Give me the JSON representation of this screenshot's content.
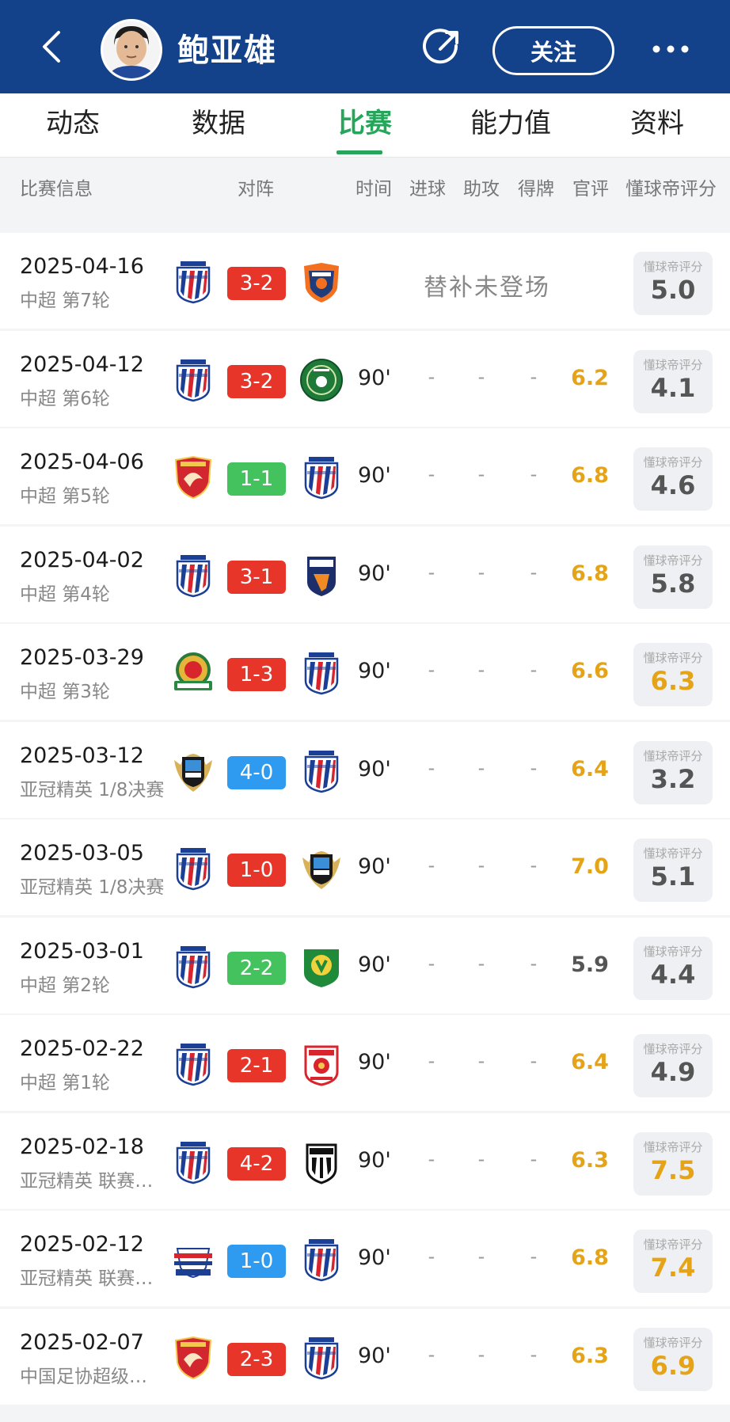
{
  "header": {
    "player_name": "鲍亚雄",
    "follow_label": "关注",
    "color": "#14428a"
  },
  "tabs": [
    {
      "label": "动态"
    },
    {
      "label": "数据"
    },
    {
      "label": "比赛",
      "active": true
    },
    {
      "label": "能力值"
    },
    {
      "label": "资料"
    }
  ],
  "columns": {
    "info": "比赛信息",
    "match": "对阵",
    "time": "时间",
    "goals": "进球",
    "assists": "助攻",
    "cards": "得牌",
    "official": "官评",
    "dqd": "懂球帝评分"
  },
  "rating_label": "懂球帝评分",
  "colors": {
    "accent_green": "#27a55a",
    "score_loss": "#e8352a",
    "score_draw": "#44c25e",
    "score_win": "#2e9bf0",
    "rating_gold": "#e5a418",
    "rating_gray": "#555555"
  },
  "matches": [
    {
      "date": "2025-04-16",
      "comp": "中超 第7轮",
      "home_icon": "shenhua-crest-icon",
      "score": "3-2",
      "score_color": "red",
      "away_icon": "dalian-crest-icon",
      "not_played": "替补未登场",
      "dqd": "5.0",
      "dqd_high": false
    },
    {
      "date": "2025-04-12",
      "comp": "中超 第6轮",
      "home_icon": "shenhua-crest-icon",
      "score": "3-2",
      "score_color": "red",
      "away_icon": "zhejiang-crest-icon",
      "time": "90'",
      "goals": "-",
      "assists": "-",
      "cards": "-",
      "official": "6.2",
      "official_high": true,
      "dqd": "4.1",
      "dqd_high": false
    },
    {
      "date": "2025-04-06",
      "comp": "中超 第5轮",
      "home_icon": "shanghai-port-crest-icon",
      "score": "1-1",
      "score_color": "green",
      "away_icon": "shenhua-crest-icon",
      "time": "90'",
      "goals": "-",
      "assists": "-",
      "cards": "-",
      "official": "6.8",
      "official_high": true,
      "dqd": "4.6",
      "dqd_high": false
    },
    {
      "date": "2025-04-02",
      "comp": "中超 第4轮",
      "home_icon": "shenhua-crest-icon",
      "score": "3-1",
      "score_color": "red",
      "away_icon": "yunnan-crest-icon",
      "time": "90'",
      "goals": "-",
      "assists": "-",
      "cards": "-",
      "official": "6.8",
      "official_high": true,
      "dqd": "5.8",
      "dqd_high": false
    },
    {
      "date": "2025-03-29",
      "comp": "中超 第3轮",
      "home_icon": "henan-crest-icon",
      "score": "1-3",
      "score_color": "red",
      "away_icon": "shenhua-crest-icon",
      "time": "90'",
      "goals": "-",
      "assists": "-",
      "cards": "-",
      "official": "6.6",
      "official_high": true,
      "dqd": "6.3",
      "dqd_high": true
    },
    {
      "date": "2025-03-12",
      "comp": "亚冠精英 1/8决赛",
      "home_icon": "kawasaki-crest-icon",
      "score": "4-0",
      "score_color": "blue",
      "away_icon": "shenhua-crest-icon",
      "time": "90'",
      "goals": "-",
      "assists": "-",
      "cards": "-",
      "official": "6.4",
      "official_high": true,
      "dqd": "3.2",
      "dqd_high": false
    },
    {
      "date": "2025-03-05",
      "comp": "亚冠精英 1/8决赛",
      "home_icon": "shenhua-crest-icon",
      "score": "1-0",
      "score_color": "red",
      "away_icon": "kawasaki-crest-icon",
      "time": "90'",
      "goals": "-",
      "assists": "-",
      "cards": "-",
      "official": "7.0",
      "official_high": true,
      "dqd": "5.1",
      "dqd_high": false
    },
    {
      "date": "2025-03-01",
      "comp": "中超 第2轮",
      "home_icon": "shenhua-crest-icon",
      "score": "2-2",
      "score_color": "green",
      "away_icon": "beijing-guoan-crest-icon",
      "time": "90'",
      "goals": "-",
      "assists": "-",
      "cards": "-",
      "official": "5.9",
      "official_high": false,
      "dqd": "4.4",
      "dqd_high": false
    },
    {
      "date": "2025-02-22",
      "comp": "中超 第1轮",
      "home_icon": "shenhua-crest-icon",
      "score": "2-1",
      "score_color": "red",
      "away_icon": "qingdao-crest-icon",
      "time": "90'",
      "goals": "-",
      "assists": "-",
      "cards": "-",
      "official": "6.4",
      "official_high": true,
      "dqd": "4.9",
      "dqd_high": false
    },
    {
      "date": "2025-02-18",
      "comp": "亚冠精英 联赛…",
      "home_icon": "shenhua-crest-icon",
      "score": "4-2",
      "score_color": "red",
      "away_icon": "vissel-crest-icon",
      "time": "90'",
      "goals": "-",
      "assists": "-",
      "cards": "-",
      "official": "6.3",
      "official_high": true,
      "dqd": "7.5",
      "dqd_high": true
    },
    {
      "date": "2025-02-12",
      "comp": "亚冠精英 联赛…",
      "home_icon": "yokohama-crest-icon",
      "score": "1-0",
      "score_color": "blue",
      "away_icon": "shenhua-crest-icon",
      "time": "90'",
      "goals": "-",
      "assists": "-",
      "cards": "-",
      "official": "6.8",
      "official_high": true,
      "dqd": "7.4",
      "dqd_high": true
    },
    {
      "date": "2025-02-07",
      "comp": "中国足协超级…",
      "home_icon": "shanghai-port-crest-icon",
      "score": "2-3",
      "score_color": "red",
      "away_icon": "shenhua-crest-icon",
      "time": "90'",
      "goals": "-",
      "assists": "-",
      "cards": "-",
      "official": "6.3",
      "official_high": true,
      "dqd": "6.9",
      "dqd_high": true
    }
  ]
}
